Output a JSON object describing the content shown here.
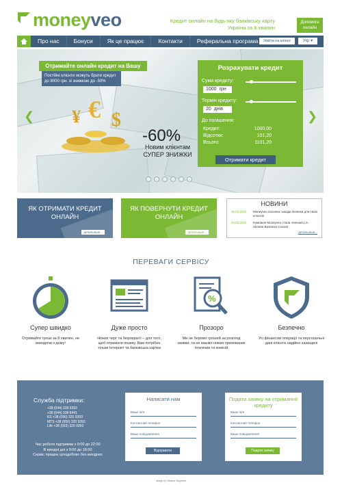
{
  "header": {
    "logo_part1": "money",
    "logo_part2": "veo",
    "tagline": "Кредит онлайн на будь-яку банківську карту України за 8 хвилин",
    "help_button": "Допомога онлайн"
  },
  "nav": {
    "items": [
      {
        "label": "Про нас"
      },
      {
        "label": "Бонуси"
      },
      {
        "label": "Як це працює"
      },
      {
        "label": "Контакти"
      },
      {
        "label": "Реферальна програма"
      }
    ],
    "login_label": "Увійти на кліент",
    "lang_label": "Укр"
  },
  "hero": {
    "promo_title": "Отримайте онлайн кредит на Вашу карту",
    "promo_text": "Постійні клієнти можуть брати кредит до 8000 грн. зі знижкою до -50%",
    "discount_value": "-60%",
    "discount_text": "Новим клієнтам СУПЕР ЗНИЖКИ",
    "slide_count": 6
  },
  "calculator": {
    "title": "Розрахувати кредит",
    "amount_label": "Сума кредиту:",
    "amount_value": "1000",
    "amount_unit": "грн",
    "term_label": "Термін кредиту:",
    "term_value": "20",
    "term_unit": "днів",
    "repay_title": "До погашення:",
    "rows": [
      {
        "label": "Кредит:",
        "value": "1000,00"
      },
      {
        "label": "Відсотки:",
        "value": "101,20"
      },
      {
        "label": "Всього:",
        "value": "1101,20"
      }
    ],
    "submit_label": "Отримати кредит"
  },
  "promo_boxes": {
    "box1_title": "ЯК ОТРИМАТИ КРЕДИТ ОНЛАЙН",
    "box2_title": "ЯК ПОВЕРНУТИ КРЕДИТ ОНЛАЙН",
    "more_label": "детальніше..."
  },
  "news": {
    "title": "НОВИНИ",
    "items": [
      {
        "date": "15.04.2016",
        "text": "Moneyveo посилює заходи безпеки для своїх клієнтів"
      },
      {
        "date": "24.03.2016",
        "text": "Компанія Moneyveo стала членом U.S.-Ukraine Business Council"
      }
    ],
    "more_label": "детальніше..."
  },
  "advantages": {
    "title": "ПЕРЕВАГИ СЕРВІСУ",
    "items": [
      {
        "name": "Супер швидко",
        "desc": "Отримайте гроші за 8 хвилин, не виходячи з дому!",
        "icon": "stopwatch-icon"
      },
      {
        "name": "Дуже просто",
        "desc": "Ніяких черг та бюрократії – для того, щоб отримати позику, Вам потрібен тільки Інтернет та банківська картка",
        "icon": "browser-window-icon"
      },
      {
        "name": "Прозоро",
        "desc": "Ми не беремо грошей за розгляд заявки, та не маємо ніяких прихованих платежів та комісій",
        "icon": "document-magnifier-icon"
      },
      {
        "name": "Безпечно",
        "desc": "Усі фінансові операції та персональні дані клієнта надійно захищені",
        "icon": "shield-icon"
      }
    ]
  },
  "support": {
    "title": "Служба підтримки:",
    "phones": [
      "+38 (044) 339 9393",
      "+38 (044) 338 8441",
      "KS  +38 (096) 320 9393",
      "MTS +38 (050) 320 9393",
      "Life  +38 (093) 320 9393"
    ],
    "hours": [
      "Час роботи підтримки з 9:00 до 22:00",
      "В вихідні дні з 9:00 до 18:00",
      "Сервіс працює цілодобово без вихідних"
    ]
  },
  "contact_form": {
    "title": "Написати нам",
    "name_placeholder": "Ваше ім'я",
    "phone_placeholder": "Контактний телефон",
    "message_placeholder": "Ваше повідомлення",
    "submit_label": "Відправити"
  },
  "apply_form": {
    "title": "Подати заявку на отримання кредиту",
    "name_placeholder": "Ваше ім'я",
    "phone_placeholder": "Контактний телефон",
    "message_placeholder": "Ваше повідомлення",
    "submit_label": "Подати заявку"
  },
  "footer": {
    "credit": "design by Oksana Yanyshka"
  },
  "colors": {
    "brand_green": "#7bb935",
    "brand_blue": "#4b6a8c",
    "nav_blue": "#3f5e7c",
    "footer_blue": "#5f7c9b"
  }
}
